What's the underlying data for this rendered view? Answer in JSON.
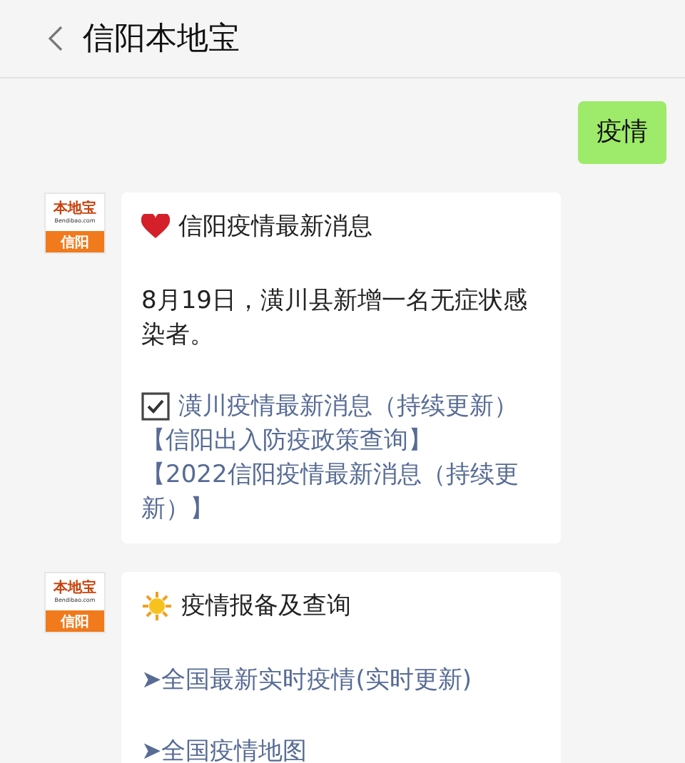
{
  "header": {
    "title": "信阳本地宝"
  },
  "messages": [
    {
      "kind": "sent",
      "text": "疫情"
    },
    {
      "kind": "received",
      "avatar": {
        "brand": "本地宝",
        "domain": "Bendibao.com",
        "city": "信阳"
      },
      "blocks": [
        {
          "kind": "heart_heading",
          "text": "信阳疫情最新消息"
        },
        {
          "kind": "paragraph",
          "text": "8月19日，潢川县新增一名无症状感染者。"
        },
        {
          "kind": "checked_link",
          "text": "潢川疫情最新消息（持续更新）"
        },
        {
          "kind": "link",
          "text": "【信阳出入防疫政策查询】"
        },
        {
          "kind": "link",
          "text": "【2022信阳疫情最新消息（持续更新）】"
        }
      ]
    },
    {
      "kind": "received",
      "avatar": {
        "brand": "本地宝",
        "domain": "Bendibao.com",
        "city": "信阳"
      },
      "blocks": [
        {
          "kind": "sun_heading",
          "text": "疫情报备及查询"
        },
        {
          "kind": "spaced_link",
          "text": "➤全国最新实时疫情(实时更新)"
        },
        {
          "kind": "spaced_link",
          "text": "➤全国疫情地图"
        }
      ]
    }
  ]
}
